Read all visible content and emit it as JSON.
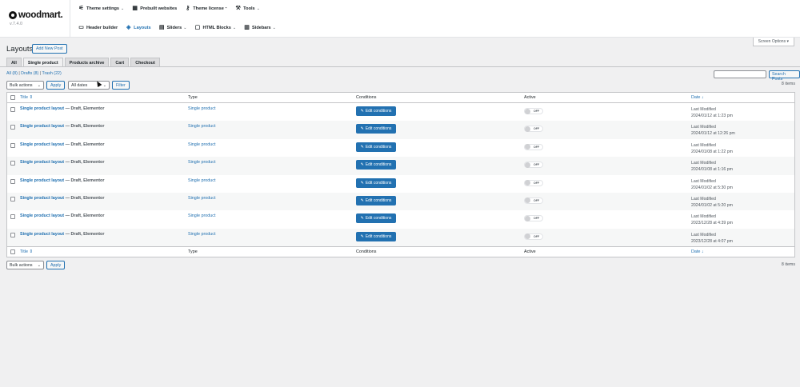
{
  "brand": {
    "name": "woodmart.",
    "version": "v.7.4.0"
  },
  "nav": {
    "row1": [
      {
        "label": "Theme settings",
        "icon": "sliders-icon",
        "chev": "⌄"
      },
      {
        "label": "Prebuilt websites",
        "icon": "grid-icon"
      },
      {
        "label": "Theme license",
        "icon": "key-icon",
        "sup": "⌃"
      },
      {
        "label": "Tools",
        "icon": "wrench-icon",
        "chev": "⌄"
      }
    ],
    "row2": [
      {
        "label": "Header builder",
        "icon": "header-icon"
      },
      {
        "label": "Layouts",
        "icon": "layers-icon"
      },
      {
        "label": "Sliders",
        "icon": "slider-icon",
        "chev": "⌄"
      },
      {
        "label": "HTML Blocks",
        "icon": "html-block-icon",
        "chev": "⌄"
      },
      {
        "label": "Sidebars",
        "icon": "sidebar-icon",
        "chev": "⌄"
      }
    ]
  },
  "screen_options": "Screen Options ▾",
  "page": {
    "title": "Layouts",
    "add_new": "Add New Post"
  },
  "tabs": [
    "All",
    "Single product",
    "Products archive",
    "Cart",
    "Checkout"
  ],
  "filters": {
    "all": "All (8)",
    "sep1": " | ",
    "drafts": "Drafts (8)",
    "sep2": " | ",
    "trash": "Trash (22)"
  },
  "search": {
    "button": "Search Posts",
    "value": ""
  },
  "items_count": "8 items",
  "bulk": {
    "label": "Bulk actions",
    "apply": "Apply",
    "dates": "All dates",
    "filter": "Filter"
  },
  "columns": {
    "title": "Title",
    "type": "Type",
    "conditions": "Conditions",
    "active": "Active",
    "date": "Date",
    "sort_title": "⇕",
    "sort_date": "↓"
  },
  "rows": [
    {
      "title": "Single product layout",
      "state": " — Draft, Elementor",
      "type": "Single product",
      "cond": "Edit conditions",
      "active": "OFF",
      "date1": "Last Modified",
      "date2": "2024/01/12 at 1:23 pm"
    },
    {
      "title": "Single product layout",
      "state": " — Draft, Elementor",
      "type": "Single product",
      "cond": "Edit conditions",
      "active": "OFF",
      "date1": "Last Modified",
      "date2": "2024/01/12 at 12:26 pm"
    },
    {
      "title": "Single product layout",
      "state": " — Draft, Elementor",
      "type": "Single product",
      "cond": "Edit conditions",
      "active": "OFF",
      "date1": "Last Modified",
      "date2": "2024/01/08 at 1:22 pm"
    },
    {
      "title": "Single product layout",
      "state": " — Draft, Elementor",
      "type": "Single product",
      "cond": "Edit conditions",
      "active": "OFF",
      "date1": "Last Modified",
      "date2": "2024/01/08 at 1:16 pm"
    },
    {
      "title": "Single product layout",
      "state": " — Draft, Elementor",
      "type": "Single product",
      "cond": "Edit conditions",
      "active": "OFF",
      "date1": "Last Modified",
      "date2": "2024/01/02 at 5:30 pm"
    },
    {
      "title": "Single product layout",
      "state": " — Draft, Elementor",
      "type": "Single product",
      "cond": "Edit conditions",
      "active": "OFF",
      "date1": "Last Modified",
      "date2": "2024/01/02 at 5:20 pm"
    },
    {
      "title": "Single product layout",
      "state": " — Draft, Elementor",
      "type": "Single product",
      "cond": "Edit conditions",
      "active": "OFF",
      "date1": "Last Modified",
      "date2": "2023/12/28 at 4:39 pm"
    },
    {
      "title": "Single product layout",
      "state": " — Draft, Elementor",
      "type": "Single product",
      "cond": "Edit conditions",
      "active": "OFF",
      "date1": "Last Modified",
      "date2": "2023/12/28 at 4:07 pm"
    }
  ],
  "colors": {
    "accent": "#2271b1",
    "bg": "#f0f0f1"
  }
}
